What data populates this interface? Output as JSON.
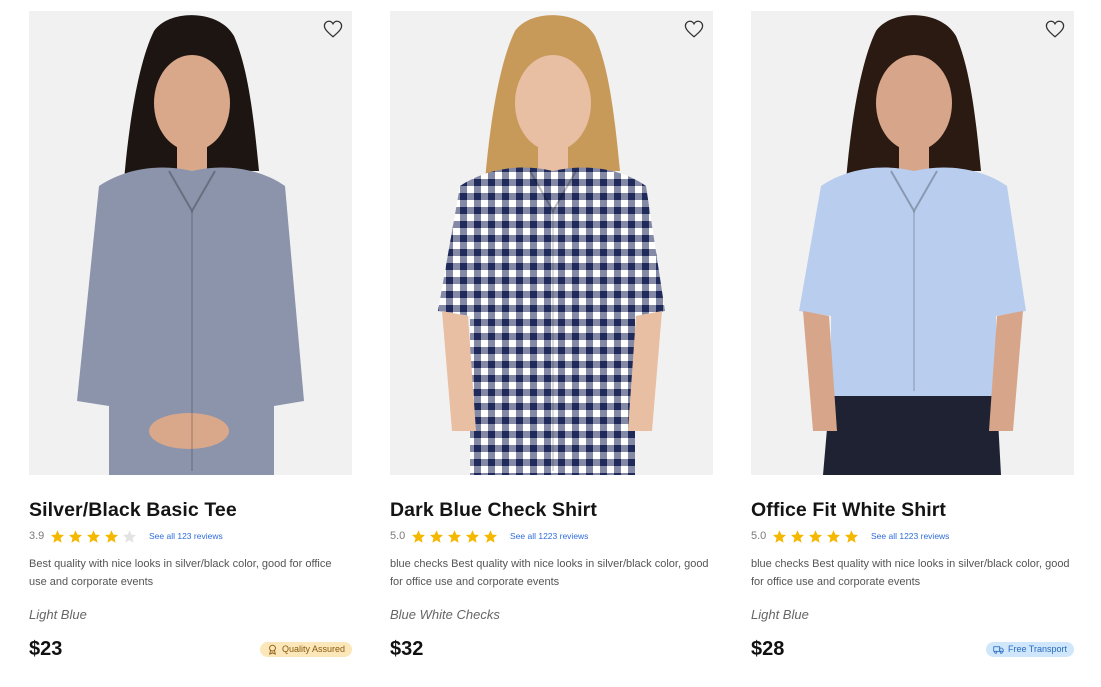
{
  "products": [
    {
      "title": "Silver/Black Basic Tee",
      "rating": "3.9",
      "rating_value": 3.9,
      "reviews_link": "See all 123 reviews",
      "description": "Best quality with nice looks in silver/black color, good for office use and corporate events",
      "color": "Light Blue",
      "price": "$23",
      "badge": "Quality Assured",
      "badge_type": "quality",
      "badge_icon": "award-icon",
      "shirt_color": "#8c94ac",
      "pattern": "solid",
      "skin": "#d9a88a",
      "hair": "#1c1512"
    },
    {
      "title": "Dark Blue Check Shirt",
      "rating": "5.0",
      "rating_value": 5,
      "reviews_link": "See all 1223 reviews",
      "description": "blue checks Best quality with nice looks in silver/black color, good for office use and corporate events",
      "color": "Blue White Checks",
      "price": "$32",
      "badge": "",
      "badge_type": "",
      "badge_icon": "",
      "shirt_color": "#1f2a5a",
      "pattern": "checks",
      "skin": "#e8bfa3",
      "hair": "#c89a5a"
    },
    {
      "title": "Office Fit White Shirt",
      "rating": "5.0",
      "rating_value": 5,
      "reviews_link": "See all 1223 reviews",
      "description": "blue checks Best quality with nice looks in silver/black color, good for office use and corporate events",
      "color": "Light Blue",
      "price": "$28",
      "badge": "Free Transport",
      "badge_type": "transport",
      "badge_icon": "truck-icon",
      "shirt_color": "#b9cdee",
      "pattern": "solid",
      "skin": "#d7a58a",
      "hair": "#2a1a12"
    }
  ],
  "colors": {
    "star_filled": "#f5b800",
    "star_empty": "#e3e3e3",
    "link": "#2f6ddb",
    "image_bg": "#f1f1f1"
  }
}
